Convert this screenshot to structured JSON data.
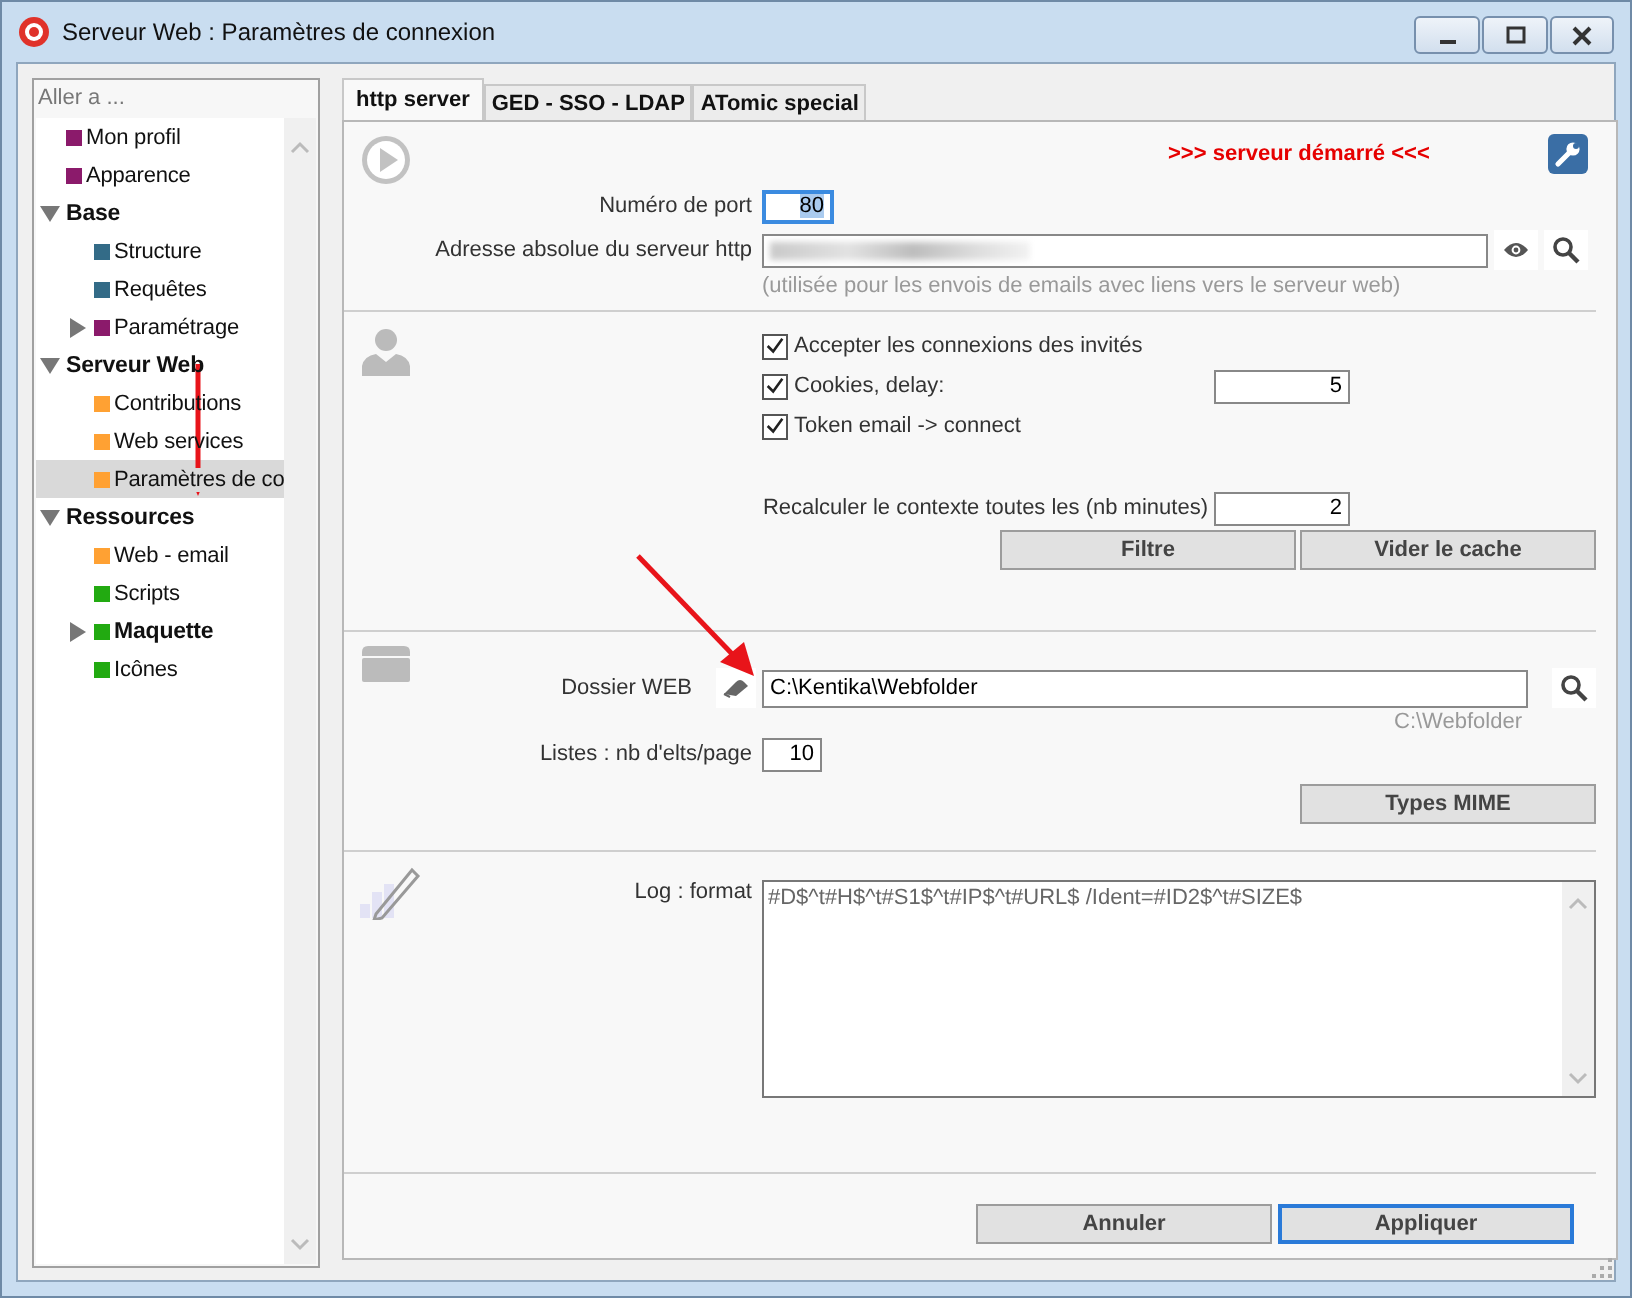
{
  "window": {
    "title": "Serveur Web : Paramètres de connexion"
  },
  "sidebar": {
    "header": "Aller a ...",
    "items": [
      {
        "label": "Mon profil",
        "color": "#8b1a6b",
        "bold": false,
        "selected": false
      },
      {
        "label": "Apparence",
        "color": "#8b1a6b",
        "bold": false,
        "selected": false
      },
      {
        "label": "Base",
        "bold": true,
        "expanded": true,
        "selected": false,
        "children": [
          {
            "label": "Structure",
            "color": "#336b87",
            "bold": false,
            "selected": false
          },
          {
            "label": "Requêtes",
            "color": "#336b87",
            "bold": false,
            "selected": false
          },
          {
            "label": "Paramétrage",
            "color": "#8b1a6b",
            "bold": false,
            "expanded": false,
            "selected": false
          }
        ]
      },
      {
        "label": "Serveur Web",
        "bold": true,
        "expanded": true,
        "selected": false,
        "children": [
          {
            "label": "Contributions",
            "color": "#ffa133",
            "bold": false,
            "selected": false
          },
          {
            "label": "Web services",
            "color": "#ffa133",
            "bold": false,
            "selected": false
          },
          {
            "label": "Paramètres de co",
            "color": "#ffa133",
            "bold": false,
            "selected": true
          }
        ]
      },
      {
        "label": "Ressources",
        "bold": true,
        "expanded": true,
        "selected": false,
        "children": [
          {
            "label": "Web - email",
            "color": "#ffa133",
            "bold": false,
            "selected": false
          },
          {
            "label": "Scripts",
            "color": "#22aa11",
            "bold": false,
            "selected": false
          },
          {
            "label": "Maquette",
            "color": "#22aa11",
            "bold": true,
            "expanded": false,
            "selected": false
          },
          {
            "label": "Icônes",
            "color": "#22aa11",
            "bold": false,
            "selected": false
          }
        ]
      }
    ]
  },
  "tabs": [
    {
      "label": "http server",
      "selected": true
    },
    {
      "label": "GED - SSO - LDAP",
      "selected": false
    },
    {
      "label": "ATomic special",
      "selected": false
    }
  ],
  "server": {
    "status": ">>> serveur démarré <<<",
    "port_label": "Numéro de port",
    "port": "80",
    "port_selected": true,
    "address_label": "Adresse absolue du serveur http",
    "address_hint": "(utilisée pour les envois de emails avec liens vers le serveur web)"
  },
  "guests": {
    "checkboxes": [
      {
        "label": "Accepter les connexions des invités",
        "checked": true
      },
      {
        "label": "Cookies, delay:",
        "checked": true,
        "value": "5"
      },
      {
        "label": "Token email -> connect",
        "checked": true
      }
    ],
    "recalc_label": "Recalculer le contexte toutes les (nb minutes)",
    "recalc": "2",
    "buttons": [
      "Filtre",
      "Vider le cache"
    ]
  },
  "folder": {
    "label": "Dossier WEB",
    "value": "C:\\Kentika\\Webfolder",
    "default_hint": "C:\\Webfolder",
    "list_label": "Listes : nb d'elts/page",
    "list_value": "10",
    "button": "Types MIME"
  },
  "log": {
    "label": "Log : format",
    "value": "#D$^t#H$^t#S1$^t#IP$^t#URL$ /Ident=#ID2$^t#SIZE$"
  },
  "footer": {
    "buttons": [
      {
        "label": "Annuler",
        "default": false
      },
      {
        "label": "Appliquer",
        "default": true
      }
    ]
  }
}
